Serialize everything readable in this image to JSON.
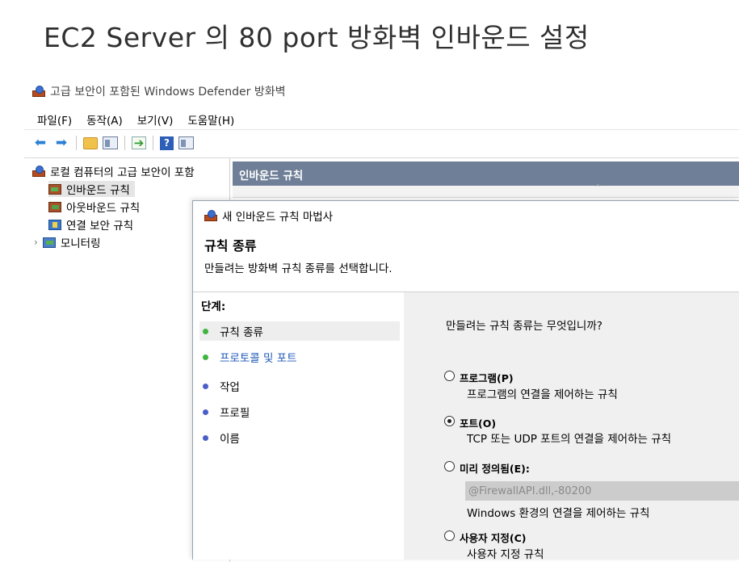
{
  "slide": {
    "title": "EC2 Server 의 80 port 방화벽 인바운드 설정"
  },
  "app": {
    "window_title": "고급 보안이 포함된 Windows Defender 방화벽",
    "menu": [
      "파일(F)",
      "동작(A)",
      "보기(V)",
      "도움말(H)"
    ],
    "toolbar": {
      "back": "back-arrow-icon",
      "forward": "forward-arrow-icon",
      "up": "folder-up-icon",
      "show_pane": "show-pane-icon",
      "export": "export-icon",
      "help": "?",
      "properties": "properties-pane-icon"
    },
    "tree": {
      "root": "로컬 컴퓨터의 고급 보안이 포함",
      "items": [
        "인바운드 규칙",
        "아웃바운드 규칙",
        "연결 보안 규칙",
        "모니터링"
      ]
    },
    "right_pane": {
      "header": "인바운드 규칙"
    }
  },
  "wizard": {
    "title": "새 인바운드 규칙 마법사",
    "heading": "규칙 종류",
    "subtitle": "만들려는 방화벽 규칙 종류를 선택합니다.",
    "steps_label": "단계:",
    "steps": [
      "규칙 종류",
      "프로토콜 및 포트",
      "작업",
      "프로필",
      "이름"
    ],
    "question": "만들려는 규칙 종류는 무엇입니까?",
    "options": [
      {
        "label": "프로그램(P)",
        "desc": "프로그램의 연결을 제어하는 규칙",
        "selected": false
      },
      {
        "label": "포트(O)",
        "desc": "TCP 또는 UDP 포트의 연결을 제어하는 규칙",
        "selected": true
      },
      {
        "label": "미리 정의됨(E):",
        "desc": "Windows 환경의 연결을 제어하는 규칙",
        "selected": false,
        "field": "@FirewallAPI.dll,-80200"
      },
      {
        "label": "사용자 지정(C)",
        "desc": "사용자 지정 규칙",
        "selected": false
      }
    ]
  }
}
